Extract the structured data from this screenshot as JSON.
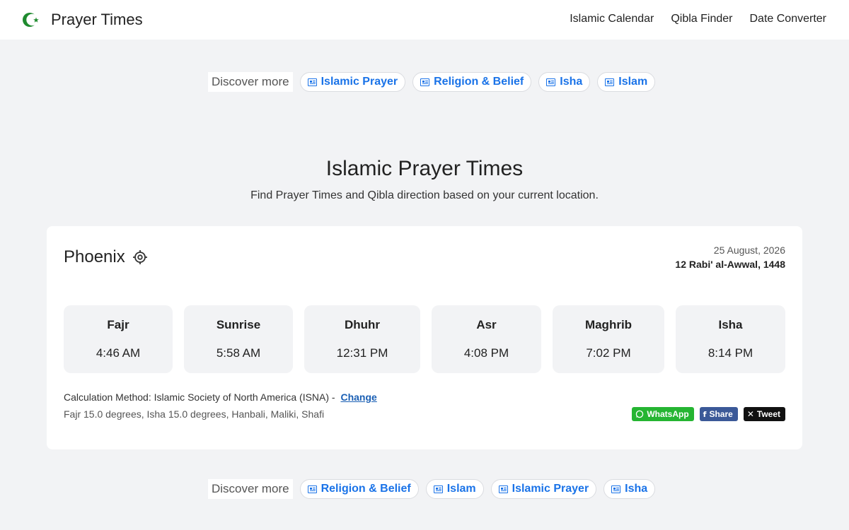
{
  "navbar": {
    "brand": "Prayer Times",
    "links": [
      "Islamic Calendar",
      "Qibla Finder",
      "Date Converter"
    ]
  },
  "discover_top": {
    "label": "Discover more",
    "chips": [
      "Islamic Prayer",
      "Religion & Belief",
      "Isha",
      "Islam"
    ]
  },
  "hero": {
    "title": "Islamic Prayer Times",
    "subtitle": "Find Prayer Times and Qibla direction based on your current location."
  },
  "card": {
    "city": "Phoenix",
    "gregorian_date": "25 August, 2026",
    "hijri_date": "12 Rabi' al-Awwal, 1448",
    "times": [
      {
        "name": "Fajr",
        "time": "4:46 AM"
      },
      {
        "name": "Sunrise",
        "time": "5:58 AM"
      },
      {
        "name": "Dhuhr",
        "time": "12:31 PM"
      },
      {
        "name": "Asr",
        "time": "4:08 PM"
      },
      {
        "name": "Maghrib",
        "time": "7:02 PM"
      },
      {
        "name": "Isha",
        "time": "8:14 PM"
      }
    ],
    "calc_method": "Calculation Method: Islamic Society of North America (ISNA) -",
    "change_label": "Change",
    "calc_detail": "Fajr 15.0 degrees, Isha 15.0 degrees, Hanbali, Maliki, Shafi",
    "share": {
      "whatsapp": "WhatsApp",
      "facebook": "Share",
      "twitter": "Tweet"
    }
  },
  "discover_bottom": {
    "label": "Discover more",
    "chips": [
      "Religion & Belief",
      "Islam",
      "Islamic Prayer",
      "Isha"
    ]
  },
  "colors": {
    "accent": "#1a73e8",
    "brand_green": "#1e8a2e",
    "whatsapp": "#25b532",
    "facebook": "#3b5998",
    "twitter": "#111111"
  }
}
